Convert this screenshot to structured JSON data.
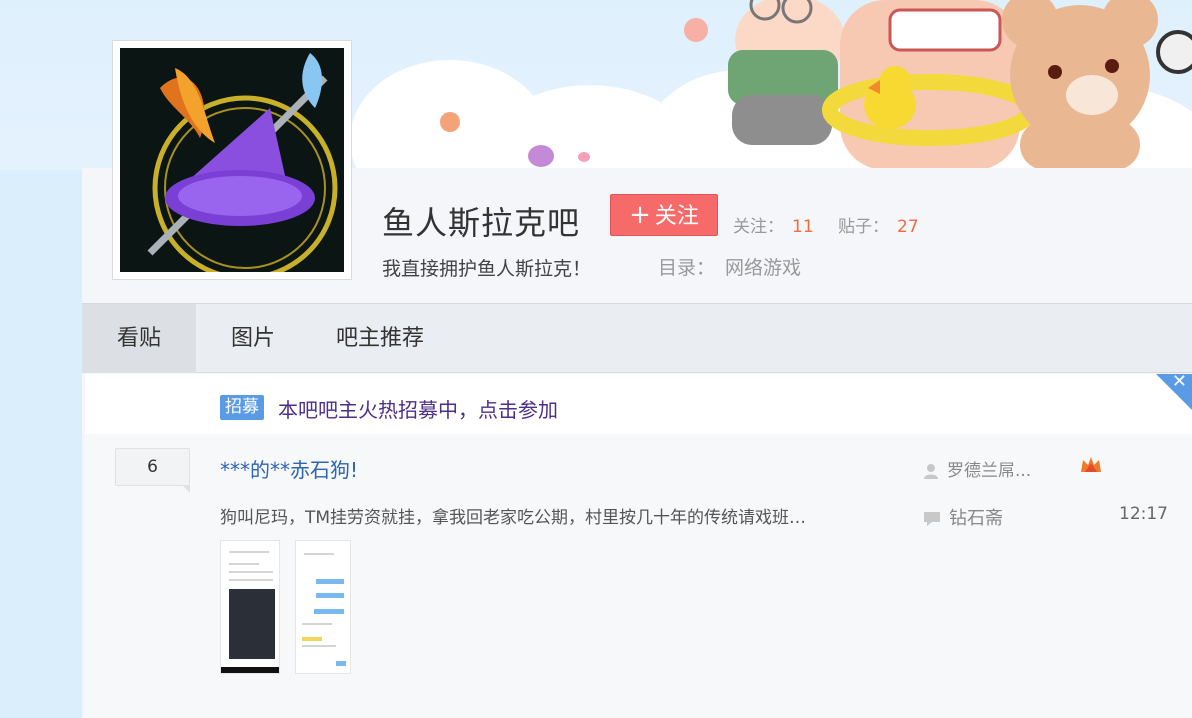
{
  "forum": {
    "name": "鱼人斯拉克吧",
    "follow_label": "关注",
    "follow_plus": "+",
    "followers_label": "关注：",
    "followers_count": "11",
    "posts_label": "贴子：",
    "posts_count": "27",
    "slogan": "我直接拥护鱼人斯拉克！",
    "category_label": "目录：",
    "category_value": "网络游戏"
  },
  "tabs": [
    {
      "label": "看贴",
      "active": true
    },
    {
      "label": "图片",
      "active": false
    },
    {
      "label": "吧主推荐",
      "active": false
    }
  ],
  "notice": {
    "tag": "招募",
    "text": "本吧吧主火热招募中，点击参加",
    "close": "✕"
  },
  "thread": {
    "reply_count": "6",
    "title": "***的**赤石狗!",
    "abstract": "狗叫尼玛，TM挂劳资就挂，拿我回老家吃公期，村里按几十年的传统请戏班…",
    "author": "罗德兰屌...",
    "last_replier": "钻石斋",
    "time": "12:17"
  },
  "colors": {
    "accent_blue": "#2d64b3",
    "follow_red": "#f66a6a",
    "count_orange": "#f26b3a",
    "notice_purple": "#4c2e8c",
    "tag_blue": "#5b9be6"
  },
  "icons": {
    "author": "user-icon",
    "last_reply": "comment-icon",
    "badge": "member-badge-icon",
    "close": "close-icon"
  }
}
